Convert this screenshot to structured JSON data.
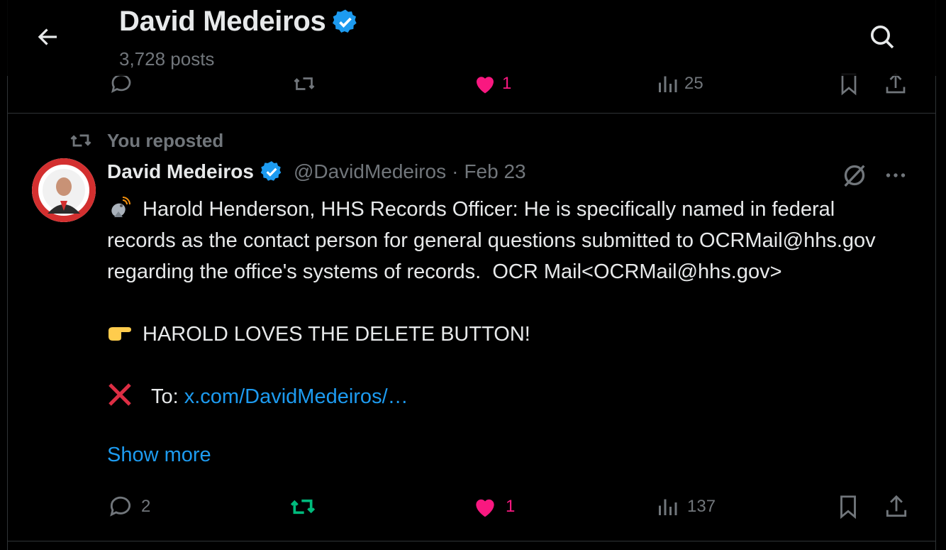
{
  "header": {
    "title": "David Medeiros",
    "posts_count": "3,728 posts"
  },
  "prev_tweet": {
    "like_count": "1",
    "views_count": "25"
  },
  "tweet": {
    "repost_label": "You reposted",
    "author_name": "David Medeiros",
    "handle": "@DavidMedeiros",
    "separator": "·",
    "date": "Feb 23",
    "paragraph1": "Harold Henderson, HHS Records Officer: He is specifically named in federal records as the contact person for general questions submitted to OCRMail@hhs.gov regarding the office's systems of records.  OCR Mail<OCRMail@hhs.gov>",
    "paragraph2": "HAROLD LOVES THE DELETE BUTTON!",
    "to_label": "To: ",
    "to_link": "x.com/DavidMedeiros/…",
    "show_more": "Show more",
    "reply_count": "2",
    "repost_count": "",
    "like_count": "1",
    "views_count": "137"
  },
  "colors": {
    "background": "#000000",
    "text": "#e7e9ea",
    "muted": "#71767b",
    "accent_blue": "#1d9bf0",
    "like_pink": "#f91880",
    "repost_green": "#00ba7c",
    "border": "#2f3336"
  }
}
